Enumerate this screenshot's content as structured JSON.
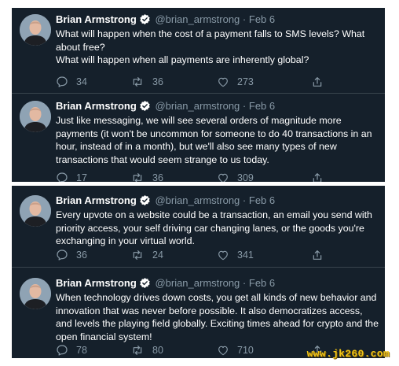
{
  "tweets": [
    {
      "name": "Brian Armstrong",
      "handle": "@brian_armstrong",
      "sep": "·",
      "date": "Feb 6",
      "text": [
        "What will happen when the cost of a payment falls to SMS levels? What about free?",
        "What will happen when all payments are inherently global?"
      ],
      "replies": "34",
      "retweets": "36",
      "likes": "273"
    },
    {
      "name": "Brian Armstrong",
      "handle": "@brian_armstrong",
      "sep": "·",
      "date": "Feb 6",
      "text": [
        "Just like messaging, we will see several orders of magnitude more payments (it won't be uncommon for someone to do 40 transactions in an hour, instead of in a month), but we'll also see many types of new transactions that would seem strange to us today."
      ],
      "replies": "17",
      "retweets": "36",
      "likes": "309"
    },
    {
      "name": "Brian Armstrong",
      "handle": "@brian_armstrong",
      "sep": "·",
      "date": "Feb 6",
      "text": [
        "Every upvote on a website could be a transaction, an email you send with priority access, your self driving car changing lanes, or the goods you're exchanging in your virtual world."
      ],
      "replies": "36",
      "retweets": "24",
      "likes": "341"
    },
    {
      "name": "Brian Armstrong",
      "handle": "@brian_armstrong",
      "sep": "·",
      "date": "Feb 6",
      "text": [
        "When technology drives down costs, you get all kinds of new behavior and innovation that was never before possible. It also democratizes access, and levels the playing field globally. Exciting times ahead for crypto and the open financial system!"
      ],
      "replies": "78",
      "retweets": "80",
      "likes": "710"
    }
  ],
  "watermark": "www.jk260.com",
  "colors": {
    "background": "#15202b",
    "text": "#ffffff",
    "muted": "#8899a6",
    "divider": "#38444d",
    "verified": "#ffffff"
  },
  "icons": [
    "verified-badge-icon",
    "reply-icon",
    "retweet-icon",
    "like-icon",
    "share-icon"
  ]
}
